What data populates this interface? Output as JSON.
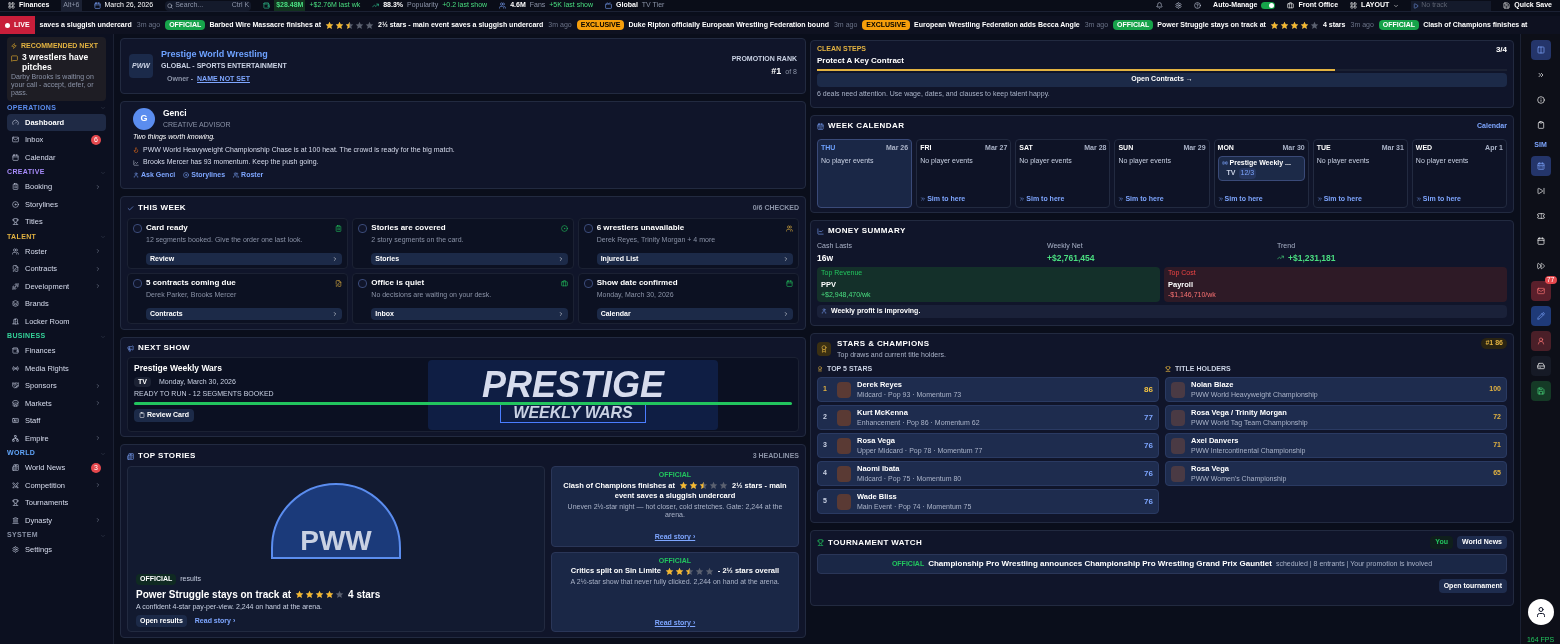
{
  "topbar": {
    "section": "Finances",
    "shortcut": "Alt+6",
    "date": "March 26, 2026",
    "search": {
      "placeholder": "Search...",
      "shortcut": "Ctrl K"
    },
    "stats": [
      {
        "value": "$28.48M",
        "delta": "+$2.76M last wk"
      },
      {
        "value": "88.3%",
        "label": "Popularity",
        "delta": "+0.2 last show"
      },
      {
        "value": "4.6M",
        "label": "Fans",
        "delta": "+5K last show"
      },
      {
        "value": "Global",
        "label": "TV Tier"
      }
    ],
    "auto_manage": {
      "label": "Auto-Manage",
      "on": true
    },
    "front_office": "Front Office",
    "layout": "LAYOUT",
    "track": {
      "placeholder": "No track"
    },
    "quick_save": "Quick Save"
  },
  "ticker": {
    "live": "LIVE",
    "items": [
      {
        "before": "saves a sluggish undercard",
        "time": "3m ago"
      },
      {
        "kind": "official",
        "tag": "OFFICIAL",
        "before": "Barbed Wire Massacre finishes at",
        "stars": 2.5,
        "after": "2½ stars - main event saves a sluggish undercard",
        "time": "3m ago"
      },
      {
        "kind": "exclusive",
        "tag": "EXCLUSIVE",
        "before": "Duke Ripton officially European Wrestling Federation bound",
        "time": "3m ago"
      },
      {
        "kind": "exclusive",
        "tag": "EXCLUSIVE",
        "before": "European Wrestling Federation adds Becca Angle",
        "time": "3m ago"
      },
      {
        "kind": "official",
        "tag": "OFFICIAL",
        "before": "Power Struggle stays on track at",
        "stars": 4,
        "after": "4 stars",
        "time": "3m ago"
      },
      {
        "kind": "official",
        "tag": "OFFICIAL",
        "before": "Clash of Champions finishes at"
      }
    ]
  },
  "sidebar": {
    "recommended": {
      "label": "RECOMMENDED NEXT",
      "title": "3 wrestlers have pitches",
      "text": "Darby Brooks is waiting on your call - accept, defer, or pass."
    },
    "sections": [
      {
        "label": "OPERATIONS",
        "items": [
          {
            "label": "Dashboard",
            "selected": true,
            "submenu": false
          },
          {
            "label": "Inbox",
            "selected": false,
            "submenu": false,
            "badge": "6"
          },
          {
            "label": "Calendar",
            "selected": false,
            "submenu": false
          }
        ]
      },
      {
        "label": "CREATIVE",
        "items": [
          {
            "label": "Booking",
            "selected": false,
            "submenu": true
          },
          {
            "label": "Storylines",
            "selected": false,
            "submenu": false
          },
          {
            "label": "Titles",
            "selected": false,
            "submenu": false
          }
        ]
      },
      {
        "label": "TALENT",
        "items": [
          {
            "label": "Roster",
            "selected": false,
            "submenu": true
          },
          {
            "label": "Contracts",
            "selected": false,
            "submenu": true
          },
          {
            "label": "Development",
            "selected": false,
            "submenu": true
          },
          {
            "label": "Brands",
            "selected": false,
            "submenu": false
          },
          {
            "label": "Locker Room",
            "selected": false,
            "submenu": false
          }
        ]
      },
      {
        "label": "BUSINESS",
        "items": [
          {
            "label": "Finances",
            "selected": false,
            "submenu": false
          },
          {
            "label": "Media Rights",
            "selected": false,
            "submenu": false
          },
          {
            "label": "Sponsors",
            "selected": false,
            "submenu": true
          },
          {
            "label": "Markets",
            "selected": false,
            "submenu": true
          },
          {
            "label": "Staff",
            "selected": false,
            "submenu": false
          },
          {
            "label": "Empire",
            "selected": false,
            "submenu": true
          }
        ]
      },
      {
        "label": "WORLD",
        "items": [
          {
            "label": "World News",
            "selected": false,
            "submenu": false,
            "badge": "3"
          },
          {
            "label": "Competition",
            "selected": false,
            "submenu": true
          },
          {
            "label": "Tournaments",
            "selected": false,
            "submenu": false
          },
          {
            "label": "Dynasty",
            "selected": false,
            "submenu": true
          }
        ]
      },
      {
        "label": "SYSTEM",
        "items": [
          {
            "label": "Settings",
            "selected": false,
            "submenu": false
          }
        ]
      }
    ]
  },
  "promotion": {
    "logo": "PWW",
    "name": "Prestige World Wrestling",
    "subtitle": "GLOBAL - SPORTS ENTERTAINMENT",
    "owner_label": "Owner -",
    "owner": "NAME NOT SET",
    "rank_label": "PROMOTION RANK",
    "rank": "#1",
    "rank_of": "of 8"
  },
  "advisor": {
    "initial": "G",
    "name": "Genci",
    "role": "CREATIVE ADVISOR",
    "intro": "Two things worth knowing.",
    "notes": [
      "PWW World Heavyweight Championship Chase is at 100 heat. The crowd is ready for the big match.",
      "Brooks Mercer has 93 momentum. Keep the push going."
    ],
    "links": [
      "Ask Genci",
      "Storylines",
      "Roster"
    ]
  },
  "this_week": {
    "title": "THIS WEEK",
    "count": "0/6 CHECKED",
    "tasks": [
      {
        "title": "Card ready",
        "detail": "12 segments booked. Give the order one last look.",
        "action": "Review",
        "checked": false
      },
      {
        "title": "Stories are covered",
        "detail": "2 story segments on the card.",
        "action": "Stories",
        "checked": false
      },
      {
        "title": "6 wrestlers unavailable",
        "detail": "Derek Reyes, Trinity Morgan + 4 more",
        "action": "Injured List",
        "checked": false
      },
      {
        "title": "5 contracts coming due",
        "detail": "Derek Parker, Brooks Mercer",
        "action": "Contracts",
        "checked": false
      },
      {
        "title": "Office is quiet",
        "detail": "No decisions are waiting on your desk.",
        "action": "Inbox",
        "checked": false
      },
      {
        "title": "Show date confirmed",
        "detail": "Monday, March 30, 2026",
        "action": "Calendar",
        "checked": false
      }
    ]
  },
  "next_show": {
    "title": "NEXT SHOW",
    "show": "Prestige Weekly Wars",
    "type": "TV",
    "date": "Monday, March 30, 2026",
    "status": "READY TO RUN - 12 SEGMENTS BOOKED",
    "level": 1,
    "button": "Review Card",
    "banner_title": "PRESTIGE",
    "banner_subtitle": "WEEKLY WARS"
  },
  "top_stories": {
    "title": "TOP STORIES",
    "count": "3 HEADLINES",
    "feature": {
      "logo": "PWW",
      "tag": "OFFICIAL",
      "category": "results",
      "before": "Power Struggle stays on track at",
      "stars": 4,
      "after": "4 stars",
      "summary": "A confident 4-star pay-per-view. 2,244 on hand at the arena.",
      "primary": "Open results",
      "link": "Read story ›"
    },
    "stories": [
      {
        "tag": "OFFICIAL",
        "before": "Clash of Champions finishes at",
        "stars": 2.5,
        "after": "2½ stars - main event saves a sluggish undercard",
        "summary": "Uneven 2½-star night — hot closer, cold stretches. Gate: 2,244 at the arena.",
        "link": "Read story ›"
      },
      {
        "tag": "OFFICIAL",
        "before": "Critics split on Sin Limite",
        "stars": 2.5,
        "after": "- 2½ stars overall",
        "summary": "A 2½-star show that never fully clicked. 2,244 on hand at the arena.",
        "link": "Read story ›"
      }
    ]
  },
  "clean_steps": {
    "label": "CLEAN STEPS",
    "title": "Protect A Key Contract",
    "progress": "3/4",
    "level": 0.75,
    "button": "Open Contracts →",
    "note": "6 deals need attention. Use wage, dates, and clauses to keep talent happy."
  },
  "week_calendar": {
    "title": "WEEK CALENDAR",
    "link": "Calendar",
    "days": [
      {
        "day": "THU",
        "date": "Mar 26",
        "selected": true,
        "text": "No player events"
      },
      {
        "day": "FRI",
        "date": "Mar 27",
        "selected": false,
        "text": "No player events",
        "sim": "Sim to here"
      },
      {
        "day": "SAT",
        "date": "Mar 28",
        "selected": false,
        "text": "No player events",
        "sim": "Sim to here"
      },
      {
        "day": "SUN",
        "date": "Mar 29",
        "selected": false,
        "text": "No player events",
        "sim": "Sim to here"
      },
      {
        "day": "MON",
        "date": "Mar 30",
        "selected": false,
        "event": {
          "title": "Prestige Weekly ...",
          "type": "TV",
          "badge": "12/3"
        },
        "sim": "Sim to here"
      },
      {
        "day": "TUE",
        "date": "Mar 31",
        "selected": false,
        "text": "No player events",
        "sim": "Sim to here"
      },
      {
        "day": "WED",
        "date": "Apr 1",
        "selected": false,
        "text": "No player events",
        "sim": "Sim to here"
      }
    ]
  },
  "money": {
    "title": "MONEY SUMMARY",
    "stats": [
      {
        "kind": "plain",
        "label": "Cash Lasts",
        "value": "16w"
      },
      {
        "kind": "positive",
        "label": "Weekly Net",
        "value": "+$2,761,454"
      },
      {
        "kind": "trend",
        "label": "Trend",
        "value": "+$1,231,181"
      }
    ],
    "revenue": {
      "label": "Top Revenue",
      "name": "PPV",
      "value": "+$2,948,470/wk"
    },
    "cost": {
      "label": "Top Cost",
      "name": "Payroll",
      "value": "-$1,146,710/wk"
    },
    "note": "Weekly profit is improving."
  },
  "stars_champions": {
    "title": "STARS & CHAMPIONS",
    "subtitle": "Top draws and current title holders.",
    "badge": "#1 86",
    "top_label": "TOP 5 STARS",
    "holders_label": "TITLE HOLDERS",
    "stars": [
      {
        "rank": "1",
        "name": "Derek Reyes",
        "detail": "Midcard · Pop 93 · Momentum 73",
        "score": "86"
      },
      {
        "rank": "2",
        "name": "Kurt McKenna",
        "detail": "Enhancement · Pop 86 · Momentum 62",
        "score": "77"
      },
      {
        "rank": "3",
        "name": "Rosa Vega",
        "detail": "Upper Midcard · Pop 78 · Momentum 77",
        "score": "76"
      },
      {
        "rank": "4",
        "name": "Naomi Ibata",
        "detail": "Midcard · Pop 75 · Momentum 80",
        "score": "76"
      },
      {
        "rank": "5",
        "name": "Wade Bliss",
        "detail": "Main Event · Pop 74 · Momentum 75",
        "score": "76"
      }
    ],
    "holders": [
      {
        "name": "Nolan Blaze",
        "title": "PWW World Heavyweight Championship",
        "score": "100"
      },
      {
        "name": "Rosa Vega / Trinity Morgan",
        "title": "PWW World Tag Team Championship",
        "score": "72"
      },
      {
        "name": "Axel Danvers",
        "title": "PWW Intercontinental Championship",
        "score": "71"
      },
      {
        "name": "Rosa Vega",
        "title": "PWW Women's Championship",
        "score": "65"
      }
    ]
  },
  "tournament": {
    "title": "TOURNAMENT WATCH",
    "filters": [
      {
        "label": "You",
        "selected": false
      },
      {
        "label": "World News",
        "selected": true
      }
    ],
    "item": {
      "tag": "OFFICIAL",
      "headline": "Championship Pro Wrestling announces Championship Pro Wrestling Grand Prix Gauntlet",
      "meta": "scheduled | 8 entrants | Your promotion is involved"
    },
    "button": "Open tournament"
  },
  "rail": {
    "label": "SIM",
    "top": [
      {
        "selected": true
      },
      {
        "selected": false
      },
      {
        "selected": false
      },
      {
        "selected": false
      }
    ],
    "sim": [
      {
        "selected": true
      },
      {
        "selected": false
      },
      {
        "selected": false
      },
      {
        "selected": false
      },
      {
        "selected": false
      }
    ],
    "actions": [
      {
        "color": "#5a1f2b",
        "badge": "77"
      },
      {
        "color": "#1f3a78"
      },
      {
        "color": "#4a1f28"
      },
      {
        "color": "#161a26"
      },
      {
        "color": "#153a26"
      }
    ]
  },
  "fps": "164 FPS"
}
